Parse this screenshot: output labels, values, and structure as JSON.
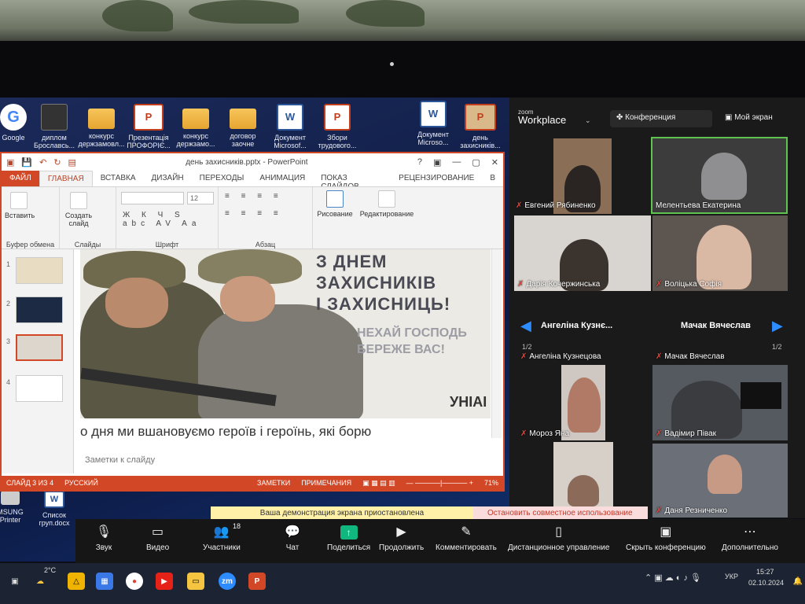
{
  "desktop": {
    "icons": [
      {
        "label": "Google",
        "icon": "google-icon"
      },
      {
        "label": "диплом Брославсь...",
        "icon": "document-icon"
      },
      {
        "label": "конкурс держзамовл...",
        "icon": "folder-icon"
      },
      {
        "label": "Презентація ПРОФОРІЄ...",
        "icon": "presentation-icon"
      },
      {
        "label": "конкурс держзамо...",
        "icon": "folder-icon"
      },
      {
        "label": "договор заочне",
        "icon": "folder-icon"
      },
      {
        "label": "Документ Microsof...",
        "icon": "word-icon"
      },
      {
        "label": "Збори трудового...",
        "icon": "powerpoint-icon"
      },
      {
        "label": "Документ Microso...",
        "icon": "word-icon"
      },
      {
        "label": "день захисників...",
        "icon": "powerpoint-icon"
      },
      {
        "label": "MSUNG Printer",
        "icon": "printer-icon"
      },
      {
        "label": "Список груп.docx",
        "icon": "word-icon"
      }
    ]
  },
  "ppt": {
    "title": "день захисників.pptx - PowerPoint",
    "window_controls": [
      "?",
      "▣",
      "—",
      "▢",
      "✕"
    ],
    "tabs": [
      "ФАЙЛ",
      "ГЛАВНАЯ",
      "ВСТАВКА",
      "ДИЗАЙН",
      "ПЕРЕХОДЫ",
      "АНИМАЦИЯ",
      "ПОКАЗ СЛАЙДОВ",
      "РЕЦЕНЗИРОВАНИЕ",
      "В"
    ],
    "active_tab": "ГЛАВНАЯ",
    "ribbon": {
      "groups": [
        "Буфер обмена",
        "Слайды",
        "Шрифт",
        "Абзац"
      ],
      "insert_label": "Вставить",
      "create_slide_label": "Создать слайд",
      "font_size": "12",
      "drawing_label": "Рисование",
      "editing_label": "Редактирование",
      "format_buttons": "Ж К Ч S abc AV Aa"
    },
    "slides": [
      "1",
      "2",
      "3",
      "4"
    ],
    "selected_slide": 3,
    "slide_text": {
      "line1": "З ДНЕМ",
      "line2": "ЗАХИСНИКІВ",
      "line3": "І ЗАХИСНИЦЬ!",
      "line4": "НЕХАЙ ГОСПОДЬ",
      "line5": "БЕРЕЖЕ ВАС!",
      "logo": "УНІАІ"
    },
    "notes_text": "о дня ми вшановуємо героїв і героїнь, які борю",
    "notes_placeholder": "Заметки к слайду",
    "status": {
      "slide_count": "СЛАЙД 3 ИЗ 4",
      "language": "РУССКИЙ",
      "notes": "ЗАМЕТКИ",
      "comments": "ПРИМЕЧАНИЯ",
      "zoom": "71%"
    }
  },
  "zoom": {
    "logo_top": "zoom",
    "logo_bottom": "Workplace",
    "conference_label": "Конференция",
    "my_screen_label": "Мой экран",
    "participants": [
      {
        "name": "Евгений Рябиненко",
        "muted": true
      },
      {
        "name": "Мелентьева Екатерина",
        "muted": false
      },
      {
        "name": "Дарія Кочержинська",
        "muted": true
      },
      {
        "name": "Воліцька Софія",
        "muted": true
      },
      {
        "name": "Ангеліна Кузнецова",
        "muted": true
      },
      {
        "name": "Мачак Вячеслав",
        "muted": true
      },
      {
        "name": "Мороз Яна",
        "muted": true
      },
      {
        "name": "Вадімир Півак",
        "muted": true
      },
      {
        "name": "Даня Резниченко",
        "muted": true
      }
    ],
    "row_headers": [
      "Ангеліна Кузнє...",
      "Мачак Вячеслав"
    ],
    "page_left": "1/2",
    "page_right": "1/2",
    "share_banner": "Ваша демонстрация экрана приостановлена",
    "stop_share": "Остановить совместное использование",
    "toolbar": [
      {
        "label": "Звук",
        "icon": "microphone-icon"
      },
      {
        "label": "Видео",
        "icon": "video-camera-icon"
      },
      {
        "label": "Участники",
        "icon": "participants-icon"
      },
      {
        "label": "Чат",
        "icon": "chat-icon"
      },
      {
        "label": "Поделиться",
        "icon": "share-icon"
      },
      {
        "label": "Продолжить",
        "icon": "play-icon"
      },
      {
        "label": "Комментировать",
        "icon": "pencil-icon"
      },
      {
        "label": "Дистанционное управление",
        "icon": "mouse-icon"
      },
      {
        "label": "Скрыть конференцию",
        "icon": "hide-icon"
      },
      {
        "label": "Дополнительно",
        "icon": "more-icon"
      }
    ],
    "participant_count": "18"
  },
  "taskbar": {
    "weather": "2°C",
    "language": "УКР",
    "time": "15:27",
    "date": "02.10.2024"
  }
}
